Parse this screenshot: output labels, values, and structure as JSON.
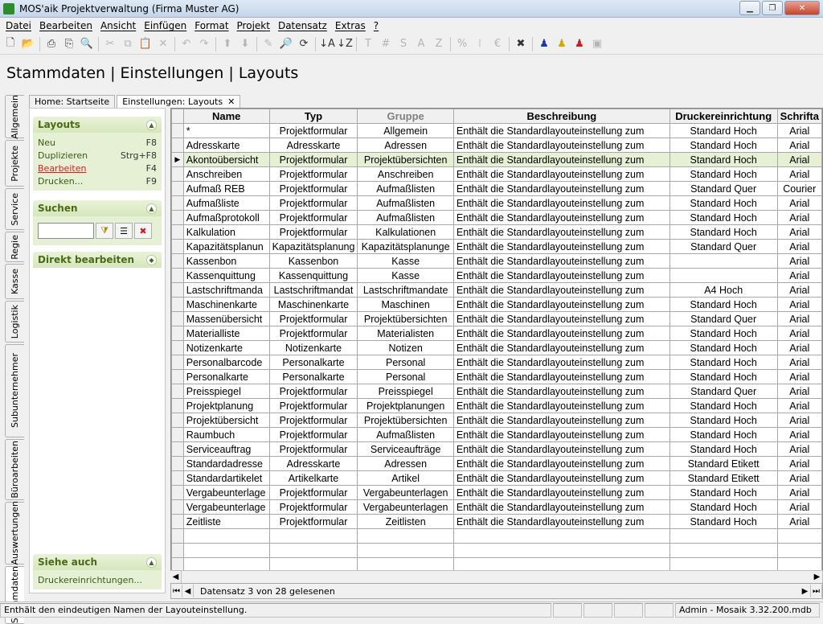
{
  "window": {
    "title": "MOS'aik Projektverwaltung (Firma Muster AG)"
  },
  "menu": [
    "Datei",
    "Bearbeiten",
    "Ansicht",
    "Einfügen",
    "Format",
    "Projekt",
    "Datensatz",
    "Extras",
    "?"
  ],
  "page_title": "Stammdaten | Einstellungen | Layouts",
  "left_tabs": [
    "Allgemein",
    "Projekte",
    "Service",
    "Regie",
    "Kasse",
    "Logistik",
    "Subunternehmer",
    "Büroarbeiten",
    "Auswertungen",
    "Stammdaten"
  ],
  "doc_tabs": [
    {
      "label": "Home: Startseite"
    },
    {
      "label": "Einstellungen: Layouts"
    }
  ],
  "sidebar": {
    "layouts_title": "Layouts",
    "actions": [
      {
        "label": "Neu",
        "key": "F8"
      },
      {
        "label": "Duplizieren",
        "key": "Strg+F8"
      },
      {
        "label": "Bearbeiten",
        "key": "F4"
      },
      {
        "label": "Drucken...",
        "key": "F9"
      }
    ],
    "search_title": "Suchen",
    "edit_title": "Direkt bearbeiten",
    "see_also_title": "Siehe auch",
    "see_also_link": "Druckereinrichtungen..."
  },
  "table": {
    "headers": [
      "Name",
      "Typ",
      "Gruppe",
      "Beschreibung",
      "Druckereinrichtung",
      "Schrifta"
    ],
    "rows": [
      [
        "*",
        "Projektformular",
        "Allgemein",
        "Enthält die Standardlayouteinstellung zum",
        "Standard Hoch",
        "Arial"
      ],
      [
        "Adresskarte",
        "Adresskarte",
        "Adressen",
        "Enthält die Standardlayouteinstellung zum",
        "Standard Hoch",
        "Arial"
      ],
      [
        "Akontoübersicht",
        "Projektformular",
        "Projektübersichten",
        "Enthält die Standardlayouteinstellung zum",
        "Standard Hoch",
        "Arial"
      ],
      [
        "Anschreiben",
        "Projektformular",
        "Anschreiben",
        "Enthält die Standardlayouteinstellung zum",
        "Standard Hoch",
        "Arial"
      ],
      [
        "Aufmaß REB",
        "Projektformular",
        "Aufmaßlisten",
        "Enthält die Standardlayouteinstellung zum",
        "Standard Quer",
        "Courier"
      ],
      [
        "Aufmaßliste",
        "Projektformular",
        "Aufmaßlisten",
        "Enthält die Standardlayouteinstellung zum",
        "Standard Hoch",
        "Arial"
      ],
      [
        "Aufmaßprotokoll",
        "Projektformular",
        "Aufmaßlisten",
        "Enthält die Standardlayouteinstellung zum",
        "Standard Hoch",
        "Arial"
      ],
      [
        "Kalkulation",
        "Projektformular",
        "Kalkulationen",
        "Enthält die Standardlayouteinstellung zum",
        "Standard Hoch",
        "Arial"
      ],
      [
        "Kapazitätsplanun",
        "Kapazitätsplanung",
        "Kapazitätsplanunge",
        "Enthält die Standardlayouteinstellung zum",
        "Standard Quer",
        "Arial"
      ],
      [
        "Kassenbon",
        "Kassenbon",
        "Kasse",
        "Enthält die Standardlayouteinstellung zum",
        "",
        "Arial"
      ],
      [
        "Kassenquittung",
        "Kassenquittung",
        "Kasse",
        "Enthält die Standardlayouteinstellung zum",
        "",
        "Arial"
      ],
      [
        "Lastschriftmanda",
        "Lastschriftmandat",
        "Lastschriftmandate",
        "Enthält die Standardlayouteinstellung zum",
        "A4 Hoch",
        "Arial"
      ],
      [
        "Maschinenkarte",
        "Maschinenkarte",
        "Maschinen",
        "Enthält die Standardlayouteinstellung zum",
        "Standard Hoch",
        "Arial"
      ],
      [
        "Massenübersicht",
        "Projektformular",
        "Projektübersichten",
        "Enthält die Standardlayouteinstellung zum",
        "Standard Quer",
        "Arial"
      ],
      [
        "Materialliste",
        "Projektformular",
        "Materialisten",
        "Enthält die Standardlayouteinstellung zum",
        "Standard Hoch",
        "Arial"
      ],
      [
        "Notizenkarte",
        "Notizenkarte",
        "Notizen",
        "Enthält die Standardlayouteinstellung zum",
        "Standard Hoch",
        "Arial"
      ],
      [
        "Personalbarcode",
        "Personalkarte",
        "Personal",
        "Enthält die Standardlayouteinstellung zum",
        "Standard Hoch",
        "Arial"
      ],
      [
        "Personalkarte",
        "Personalkarte",
        "Personal",
        "Enthält die Standardlayouteinstellung zum",
        "Standard Hoch",
        "Arial"
      ],
      [
        "Preisspiegel",
        "Projektformular",
        "Preisspiegel",
        "Enthält die Standardlayouteinstellung zum",
        "Standard Quer",
        "Arial"
      ],
      [
        "Projektplanung",
        "Projektformular",
        "Projektplanungen",
        "Enthält die Standardlayouteinstellung zum",
        "Standard Hoch",
        "Arial"
      ],
      [
        "Projektübersicht",
        "Projektformular",
        "Projektübersichten",
        "Enthält die Standardlayouteinstellung zum",
        "Standard Hoch",
        "Arial"
      ],
      [
        "Raumbuch",
        "Projektformular",
        "Aufmaßlisten",
        "Enthält die Standardlayouteinstellung zum",
        "Standard Hoch",
        "Arial"
      ],
      [
        "Serviceauftrag",
        "Projektformular",
        "Serviceaufträge",
        "Enthält die Standardlayouteinstellung zum",
        "Standard Hoch",
        "Arial"
      ],
      [
        "Standardadresse",
        "Adresskarte",
        "Adressen",
        "Enthält die Standardlayouteinstellung zum",
        "Standard Etikett",
        "Arial"
      ],
      [
        "Standardartikelet",
        "Artikelkarte",
        "Artikel",
        "Enthält die Standardlayouteinstellung zum",
        "Standard Etikett",
        "Arial"
      ],
      [
        "Vergabeunterlage",
        "Projektformular",
        "Vergabeunterlagen",
        "Enthält die Standardlayouteinstellung zum",
        "Standard Hoch",
        "Arial"
      ],
      [
        "Vergabeunterlage",
        "Projektformular",
        "Vergabeunterlagen",
        "Enthält die Standardlayouteinstellung zum",
        "Standard Hoch",
        "Arial"
      ],
      [
        "Zeitliste",
        "Projektformular",
        "Zeitlisten",
        "Enthält die Standardlayouteinstellung zum",
        "Standard Hoch",
        "Arial"
      ]
    ],
    "selected_index": 2,
    "empty_rows": 3
  },
  "navbar": {
    "record_text": "Datensatz 3 von 28 gelesenen"
  },
  "status": {
    "hint": "Enthält den eindeutigen Namen der Layouteinstellung.",
    "user": "Admin - Mosaik 3.32.200.mdb"
  },
  "colors": {
    "panel_green": "#e6f0d5",
    "header_green": "#4a6a16",
    "link_red": "#d02020"
  }
}
